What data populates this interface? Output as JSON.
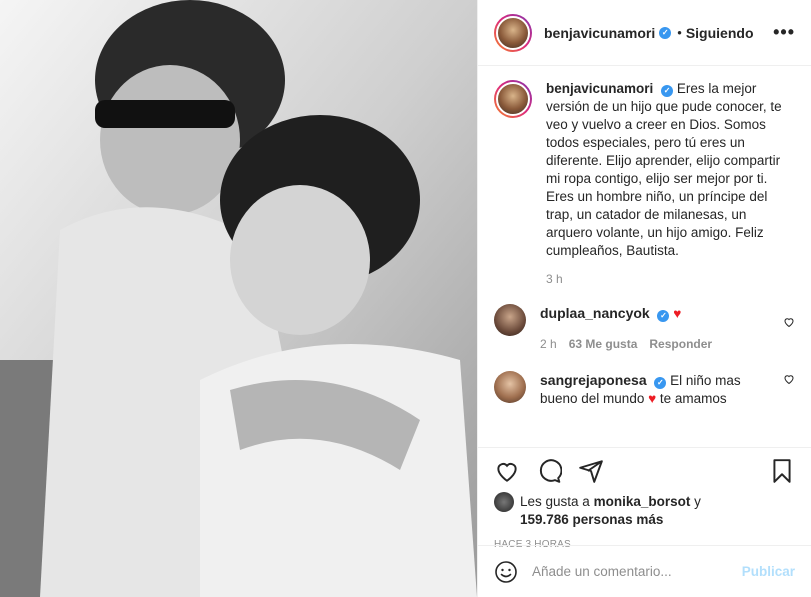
{
  "post": {
    "photo_alt": "Foto en blanco y negro",
    "author": "benjavicunamori",
    "following_label": "Siguiendo",
    "more_label": "•••",
    "caption": "Eres la mejor versión de un hijo que pude conocer, te veo y vuelvo a creer en Dios. Somos todos especiales, pero tú eres un diferente. Elijo aprender, elijo compartir mi ropa contigo, elijo ser mejor por ti. Eres un hombre niño, un príncipe del trap, un catador de milanesas, un arquero volante, un hijo amigo. Feliz cumpleaños, Bautista.",
    "caption_time": "3 h"
  },
  "comments": [
    {
      "user": "duplaa_nancyok",
      "text": "",
      "emoji": "♥",
      "time": "2 h",
      "likes": "63 Me gusta",
      "reply": "Responder"
    },
    {
      "user": "sangrejaponesa",
      "text_before": "El niño mas bueno del mundo",
      "emoji": "♥",
      "text_after": "te amamos"
    }
  ],
  "likes": {
    "prefix": "Les gusta a",
    "user": "monika_borsot",
    "conjunction": "y",
    "count": "159.786 personas más"
  },
  "timestamp": "HACE 3 HORAS",
  "add_comment": {
    "placeholder": "Añade un comentario...",
    "publish": "Publicar"
  },
  "colors": {
    "accent": "#3897f0",
    "publish_disabled": "#b2dffc",
    "heart": "#ed1c24"
  },
  "icons": [
    "heart-icon",
    "comment-icon",
    "share-icon",
    "bookmark-icon",
    "emoji-icon",
    "verified-icon",
    "like-small-icon"
  ]
}
